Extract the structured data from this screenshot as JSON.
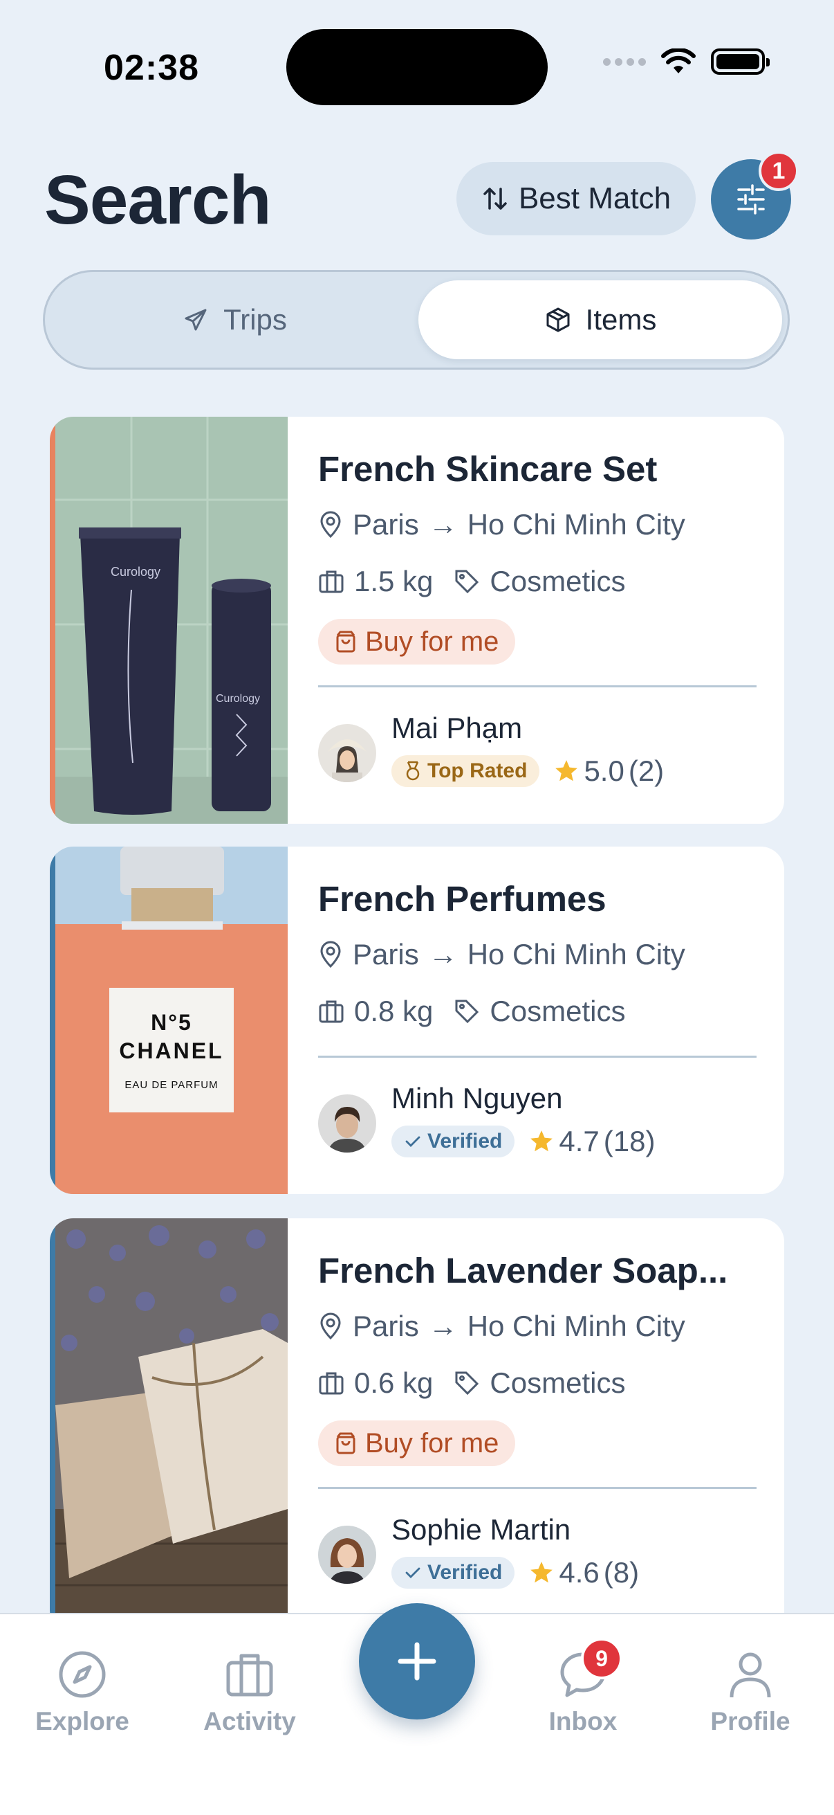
{
  "status_bar": {
    "time": "02:38"
  },
  "header": {
    "title": "Search",
    "sort_label": "Best Match",
    "filter_count": "1"
  },
  "segment": {
    "tabs": [
      {
        "label": "Trips",
        "active": false
      },
      {
        "label": "Items",
        "active": true
      }
    ]
  },
  "items": [
    {
      "title": "French Skincare Set",
      "from": "Paris",
      "to": "Ho Chi Minh City",
      "arrow": "→",
      "weight": "1.5 kg",
      "category": "Cosmetics",
      "buy_for_me": "Buy for me",
      "accent_color": "#e8835f",
      "owner": {
        "name": "Mai Phạm",
        "badge": "Top Rated",
        "rating": "5.0",
        "reviews": "(2)"
      }
    },
    {
      "title": "French Perfumes",
      "from": "Paris",
      "to": "Ho Chi Minh City",
      "arrow": "→",
      "weight": "0.8 kg",
      "category": "Cosmetics",
      "accent_color": "#3e7ba7",
      "image_text": {
        "line1": "N°5",
        "line2": "CHANEL",
        "line3": "EAU DE PARFUM"
      },
      "owner": {
        "name": "Minh Nguyen",
        "badge": "Verified",
        "rating": "4.7",
        "reviews": "(18)"
      }
    },
    {
      "title": "French Lavender Soap...",
      "from": "Paris",
      "to": "Ho Chi Minh City",
      "arrow": "→",
      "weight": "0.6 kg",
      "category": "Cosmetics",
      "buy_for_me": "Buy for me",
      "accent_color": "#3e7ba7",
      "owner": {
        "name": "Sophie Martin",
        "badge": "Verified",
        "rating": "4.6",
        "reviews": "(8)"
      }
    }
  ],
  "nav": {
    "explore": "Explore",
    "activity": "Activity",
    "inbox": "Inbox",
    "inbox_count": "9",
    "profile": "Profile"
  },
  "colors": {
    "primary": "#3e7ba7",
    "badge_red": "#e0353c",
    "background": "#e9f0f8"
  }
}
